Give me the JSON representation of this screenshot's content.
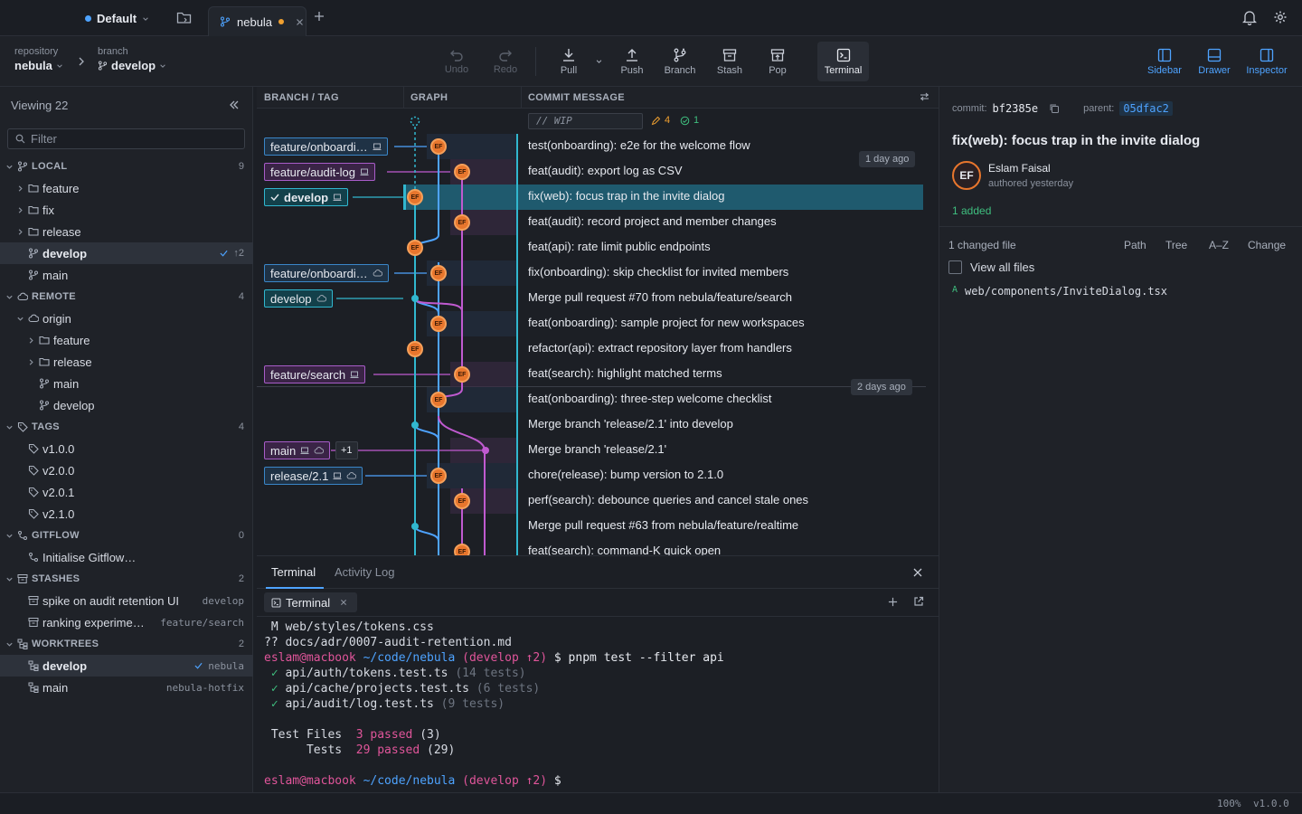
{
  "titlebar": {
    "workspace": "Default",
    "tab_label": "nebula"
  },
  "toolbar": {
    "repo_label": "repository",
    "repo_value": "nebula",
    "branch_label": "branch",
    "branch_value": "develop",
    "undo": "Undo",
    "redo": "Redo",
    "pull": "Pull",
    "push": "Push",
    "branch": "Branch",
    "stash": "Stash",
    "pop": "Pop",
    "terminal": "Terminal",
    "sidebar": "Sidebar",
    "drawer": "Drawer",
    "inspector": "Inspector"
  },
  "sidebar": {
    "viewing": "Viewing 22",
    "filter_placeholder": "Filter",
    "local": "LOCAL",
    "local_count": "9",
    "local_feature": "feature",
    "local_fix": "fix",
    "local_release": "release",
    "local_develop": "develop",
    "local_develop_badge": "↑2",
    "local_main": "main",
    "remote": "REMOTE",
    "remote_count": "4",
    "origin": "origin",
    "remote_feature": "feature",
    "remote_release": "release",
    "remote_main": "main",
    "remote_develop": "develop",
    "tags": "TAGS",
    "tags_count": "4",
    "tag1": "v1.0.0",
    "tag2": "v2.0.0",
    "tag3": "v2.0.1",
    "tag4": "v2.1.0",
    "gitflow": "GITFLOW",
    "gitflow_count": "0",
    "gitflow_init": "Initialise Gitflow…",
    "stashes": "STASHES",
    "stashes_count": "2",
    "stash1": "spike on audit retention UI",
    "stash1_branch": "develop",
    "stash2": "ranking experime…",
    "stash2_branch": "feature/search",
    "worktrees": "WORKTREES",
    "worktrees_count": "2",
    "wt1": "develop",
    "wt1_sub": "nebula",
    "wt2": "main",
    "wt2_sub": "nebula-hotfix"
  },
  "graph": {
    "col_branch": "BRANCH / TAG",
    "col_graph": "GRAPH",
    "col_msg": "COMMIT MESSAGE",
    "wip": "// WIP",
    "wip_edits": "4",
    "wip_checks": "1",
    "age1": "1 day ago",
    "age2": "2 days ago",
    "avatar_initials": "EF",
    "refs": {
      "r1": "feature/onboardi…",
      "r2": "feature/audit-log",
      "r3": "develop",
      "r4": "feature/onboardi…",
      "r5": "develop",
      "r6": "feature/search",
      "r7": "main",
      "r7_more": "+1",
      "r8": "release/2.1"
    },
    "messages": [
      "test(onboarding): e2e for the welcome flow",
      "feat(audit): export log as CSV",
      "fix(web): focus trap in the invite dialog",
      "feat(audit): record project and member changes",
      "feat(api): rate limit public endpoints",
      "fix(onboarding): skip checklist for invited members",
      "Merge pull request #70 from nebula/feature/search",
      "feat(onboarding): sample project for new workspaces",
      "refactor(api): extract repository layer from handlers",
      "feat(search): highlight matched terms",
      "feat(onboarding): three-step welcome checklist",
      "Merge branch 'release/2.1' into develop",
      "Merge branch 'release/2.1'",
      "chore(release): bump version to 2.1.0",
      "perf(search): debounce queries and cancel stale ones",
      "Merge pull request #63 from nebula/feature/realtime",
      "feat(search): command-K quick open"
    ]
  },
  "bottom": {
    "tab_terminal": "Terminal",
    "tab_activity": "Activity Log",
    "subtab": "Terminal",
    "lines": [
      {
        "segs": [
          {
            "t": " M web/styles/tokens.css",
            "c": "#d7dbe3"
          }
        ]
      },
      {
        "segs": [
          {
            "t": "?? docs/adr/0007-audit-retention.md",
            "c": "#d7dbe3"
          }
        ]
      },
      {
        "segs": [
          {
            "t": "eslam@macbook",
            "c": "#e0559a"
          },
          {
            "t": " ~/code/nebula",
            "c": "#4ea3ff"
          },
          {
            "t": " (develop ↑2)",
            "c": "#e0559a"
          },
          {
            "t": " $ pnpm test --filter api",
            "c": "#e6e9ef"
          }
        ]
      },
      {
        "segs": [
          {
            "t": " ✓ ",
            "c": "#3fbf7f"
          },
          {
            "t": "api/auth/tokens.test.ts",
            "c": "#d7dbe3"
          },
          {
            "t": " (14 tests)",
            "c": "#6d7480"
          }
        ]
      },
      {
        "segs": [
          {
            "t": " ✓ ",
            "c": "#3fbf7f"
          },
          {
            "t": "api/cache/projects.test.ts",
            "c": "#d7dbe3"
          },
          {
            "t": " (6 tests)",
            "c": "#6d7480"
          }
        ]
      },
      {
        "segs": [
          {
            "t": " ✓ ",
            "c": "#3fbf7f"
          },
          {
            "t": "api/audit/log.test.ts",
            "c": "#d7dbe3"
          },
          {
            "t": " (9 tests)",
            "c": "#6d7480"
          }
        ]
      },
      {
        "segs": [
          {
            "t": " ",
            "c": "#d7dbe3"
          }
        ]
      },
      {
        "segs": [
          {
            "t": " Test Files  ",
            "c": "#d7dbe3"
          },
          {
            "t": "3 passed",
            "c": "#e0559a"
          },
          {
            "t": " (3)",
            "c": "#d7dbe3"
          }
        ]
      },
      {
        "segs": [
          {
            "t": "      Tests  ",
            "c": "#d7dbe3"
          },
          {
            "t": "29 passed",
            "c": "#e0559a"
          },
          {
            "t": " (29)",
            "c": "#d7dbe3"
          }
        ]
      },
      {
        "segs": [
          {
            "t": " ",
            "c": "#d7dbe3"
          }
        ]
      },
      {
        "segs": [
          {
            "t": "eslam@macbook",
            "c": "#e0559a"
          },
          {
            "t": " ~/code/nebula",
            "c": "#4ea3ff"
          },
          {
            "t": " (develop ↑2)",
            "c": "#e0559a"
          },
          {
            "t": " $",
            "c": "#e6e9ef"
          }
        ]
      }
    ]
  },
  "inspector": {
    "commit_label": "commit:",
    "commit_hash": "bf2385e",
    "parent_label": "parent:",
    "parent_hash": "05dfac2",
    "title": "fix(web): focus trap in the invite dialog",
    "initials": "EF",
    "author": "Eslam Faisal",
    "authored": "authored yesterday",
    "added": "1 added",
    "changed": "1 changed file",
    "sort_path": "Path",
    "sort_tree": "Tree",
    "sort_az": "A–Z",
    "sort_change": "Change",
    "view_all": "View all files",
    "file_status": "A",
    "file_path": "web/components/InviteDialog.tsx"
  },
  "status": {
    "zoom": "100%",
    "version": "v1.0.0"
  }
}
